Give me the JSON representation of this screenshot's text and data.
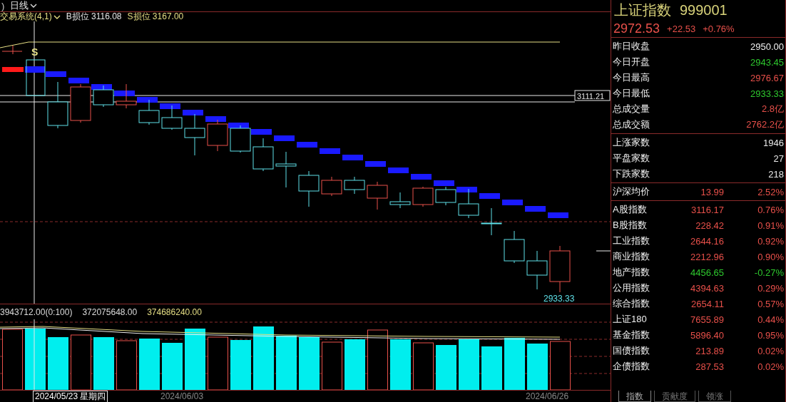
{
  "top_bar": {
    "prefix": ")",
    "period": "日线"
  },
  "indicator": {
    "name": "交易系统(4,1)",
    "b_stop": {
      "label": "B损位",
      "value": "3116.08"
    },
    "s_stop": {
      "label": "S损位",
      "value": "3167.00"
    }
  },
  "chart": {
    "price_line_label": "3111.21",
    "low_label": "2933.33",
    "signal": "S"
  },
  "volume": {
    "readings": [
      "3943712.00(0:100)",
      "372075648.00",
      "374686240.00"
    ]
  },
  "date_axis": {
    "cursor_date": "2024/05/23 星期四",
    "ticks": [
      "2024/06/03",
      "2024/06/26"
    ]
  },
  "quote": {
    "name": "上证指数",
    "code": "999001",
    "price": "2972.53",
    "change": "+22.53",
    "change_pct": "+0.76%",
    "color": "#e8504a"
  },
  "stats": [
    {
      "label": "昨日收盘",
      "value": "2950.00",
      "color": "#f0f0f0"
    },
    {
      "label": "今日开盘",
      "value": "2943.45",
      "color": "#2ec82e"
    },
    {
      "label": "今日最高",
      "value": "2976.67",
      "color": "#e8504a"
    },
    {
      "label": "今日最低",
      "value": "2933.33",
      "color": "#2ec82e"
    },
    {
      "label": "总成交量",
      "value": "2.8亿",
      "color": "#e8504a"
    },
    {
      "label": "总成交额",
      "value": "2762.2亿",
      "color": "#e8504a"
    }
  ],
  "breadth": [
    {
      "label": "上涨家数",
      "value": "1946"
    },
    {
      "label": "平盘家数",
      "value": "27"
    },
    {
      "label": "下跌家数",
      "value": "218"
    }
  ],
  "average": {
    "label": "沪深均价",
    "value": "13.99",
    "pct": "2.52%"
  },
  "indices": [
    {
      "label": "A股指数",
      "value": "3116.17",
      "pct": "0.76%",
      "color": "#e8504a"
    },
    {
      "label": "B股指数",
      "value": "228.42",
      "pct": "0.91%",
      "color": "#e8504a"
    },
    {
      "label": "工业指数",
      "value": "2644.16",
      "pct": "0.92%",
      "color": "#e8504a"
    },
    {
      "label": "商业指数",
      "value": "2212.96",
      "pct": "0.90%",
      "color": "#e8504a"
    },
    {
      "label": "地产指数",
      "value": "4456.65",
      "pct": "-0.27%",
      "color": "#2ec82e"
    },
    {
      "label": "公用指数",
      "value": "4394.63",
      "pct": "0.29%",
      "color": "#e8504a"
    },
    {
      "label": "综合指数",
      "value": "2654.11",
      "pct": "0.57%",
      "color": "#e8504a"
    },
    {
      "label": "上证180",
      "value": "7655.89",
      "pct": "0.44%",
      "color": "#e8504a"
    },
    {
      "label": "基金指数",
      "value": "5896.40",
      "pct": "0.95%",
      "color": "#e8504a"
    },
    {
      "label": "国债指数",
      "value": "213.89",
      "pct": "0.02%",
      "color": "#e8504a"
    },
    {
      "label": "企债指数",
      "value": "287.53",
      "pct": "0.02%",
      "color": "#e8504a"
    }
  ],
  "tabs": [
    {
      "label": "指数",
      "selected": true
    },
    {
      "label": "贡献度",
      "selected": false
    },
    {
      "label": "领涨",
      "selected": false
    }
  ]
}
